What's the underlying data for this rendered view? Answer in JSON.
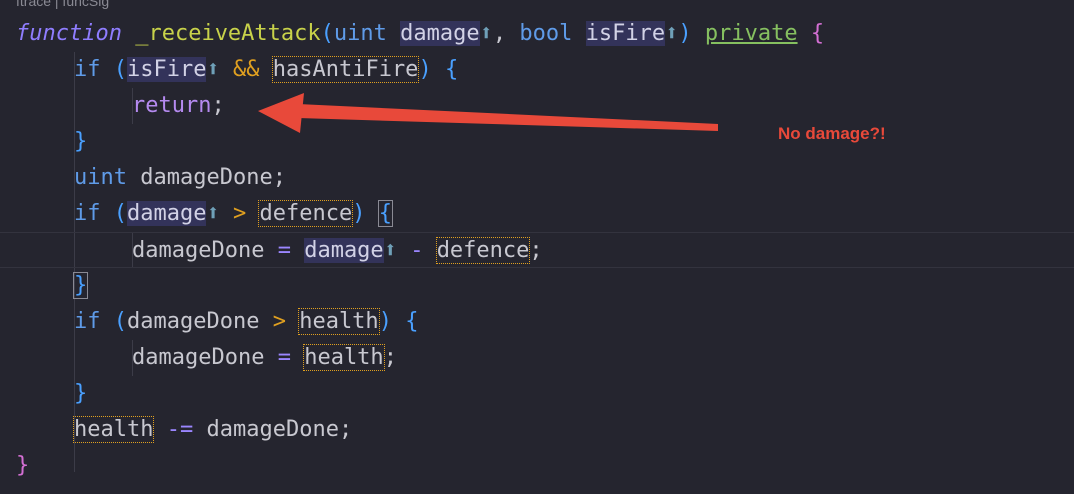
{
  "codelens": "ftrace | funcSig",
  "annotation": {
    "text": "No damage?!",
    "color": "#e8493a"
  },
  "theme": {
    "background": "#25252f",
    "keyword_color": "#5f9be8",
    "function_color": "#c8d24a",
    "highlight_border": "#e0a020"
  },
  "code": {
    "line1": {
      "kw_function": "function",
      "fn_name": "_receiveAttack",
      "open_paren": "(",
      "type_uint": "uint",
      "param_damage": "damage",
      "arrow1": "⬆",
      "comma": ",",
      "type_bool": "bool",
      "param_isfire": "isFire",
      "arrow2": "⬆",
      "close_paren": ")",
      "kw_private": "private",
      "open_brace": "{"
    },
    "line2": {
      "kw_if": "if",
      "open_paren": "(",
      "param_isfire": "isFire",
      "arrow": "⬆",
      "op_and": "&&",
      "var_hasantifire": "hasAntiFire",
      "close_paren": ")",
      "open_brace": "{"
    },
    "line3": {
      "kw_return": "return",
      "semicolon": ";"
    },
    "line4": {
      "close_brace": "}"
    },
    "line5": {
      "type_uint": "uint",
      "var_damagedone": "damageDone",
      "semicolon": ";"
    },
    "line6": {
      "kw_if": "if",
      "open_paren": "(",
      "param_damage": "damage",
      "arrow": "⬆",
      "op_gt": ">",
      "var_defence": "defence",
      "close_paren": ")",
      "open_brace": "{"
    },
    "line7": {
      "var_damagedone": "damageDone",
      "op_assign": "=",
      "param_damage": "damage",
      "arrow": "⬆",
      "op_minus": "-",
      "var_defence": "defence",
      "semicolon": ";"
    },
    "line8": {
      "close_brace": "}"
    },
    "line9": {
      "kw_if": "if",
      "open_paren": "(",
      "var_damagedone": "damageDone",
      "op_gt": ">",
      "var_health": "health",
      "close_paren": ")",
      "open_brace": "{"
    },
    "line10": {
      "var_damagedone": "damageDone",
      "op_assign": "=",
      "var_health": "health",
      "semicolon": ";"
    },
    "line11": {
      "close_brace": "}"
    },
    "line12": {
      "var_health": "health",
      "op_subassign": "-=",
      "var_damagedone": "damageDone",
      "semicolon": ";"
    },
    "line13": {
      "close_brace": "}"
    }
  }
}
